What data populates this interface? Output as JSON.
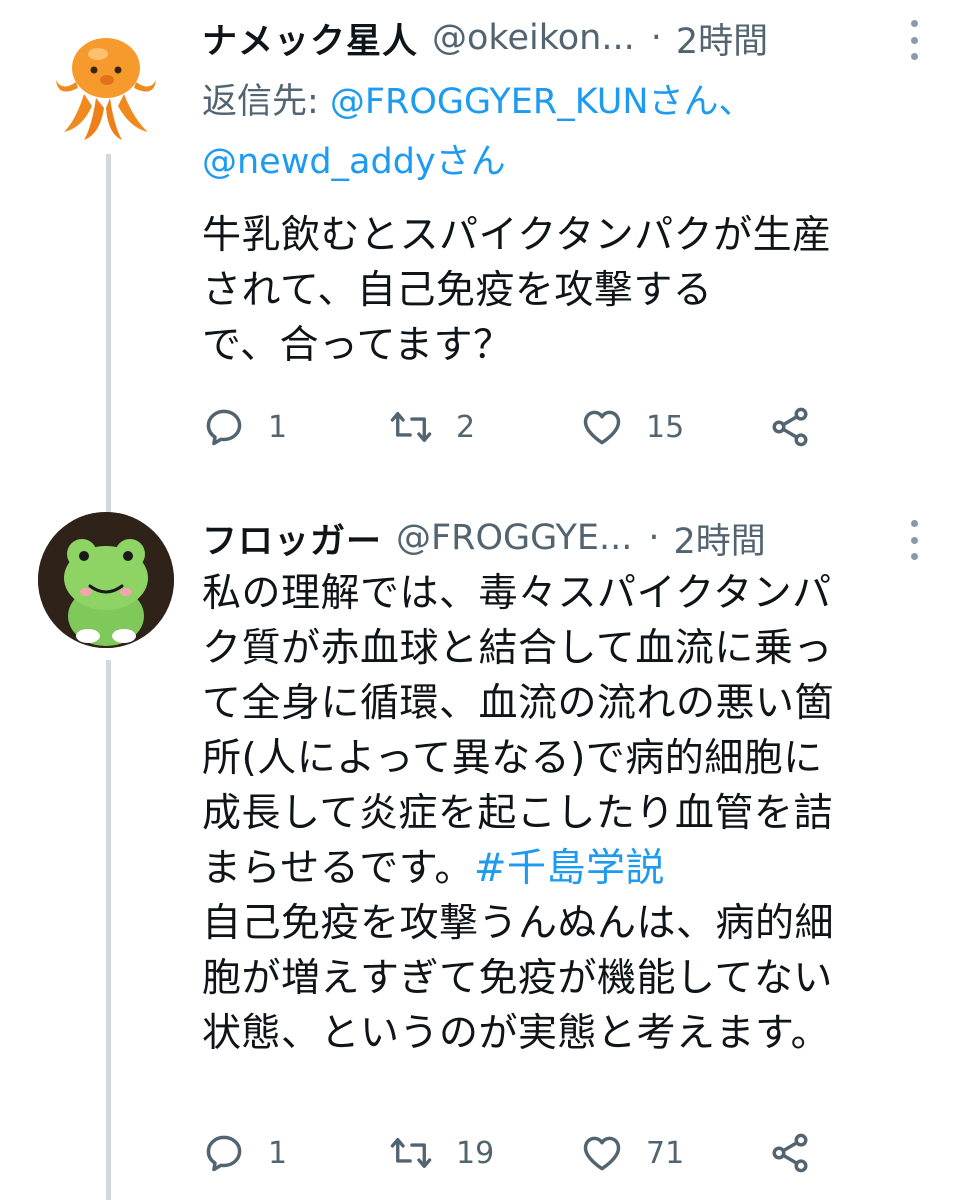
{
  "tweets": [
    {
      "name": "ナメック星人",
      "handle": "@okeikon...",
      "separator": "·",
      "time": "2時間",
      "reply_prefix": "返信先: ",
      "reply_users": "@FROGGYER_KUNさん、",
      "reply_users_2": "@newd_addyさん",
      "body_lines": [
        "牛乳飲むとスパイクタンパクが生産",
        "されて、自己免疫を攻撃する",
        "で、合ってます？"
      ],
      "replies": "1",
      "retweets": "2",
      "likes": "15",
      "avatar_icon": "octopus-avatar-icon"
    },
    {
      "name": "フロッガー",
      "handle": "@FROGGYE...",
      "separator": "·",
      "time": "2時間",
      "body_lines": [
        "私の理解では、毒々スパイクタンパ",
        "ク質が赤血球と結合して血流に乗っ",
        "て全身に循環、血流の流れの悪い箇",
        "所(人によって異なる)で病的細胞に",
        "成長して炎症を起こしたり血管を詰",
        "まらせるです。",
        "自己免疫を攻撃うんぬんは、病的細",
        "胞が増えすぎて免疫が機能してない",
        "状態、というのが実態と考えます。"
      ],
      "hashtag": "#千島学説",
      "replies": "1",
      "retweets": "19",
      "likes": "71",
      "avatar_icon": "frog-plush-avatar-icon"
    }
  ],
  "colors": {
    "link": "#1d9bf0",
    "muted": "#536471",
    "text": "#0f1419",
    "thread_line": "#cfd9de"
  }
}
